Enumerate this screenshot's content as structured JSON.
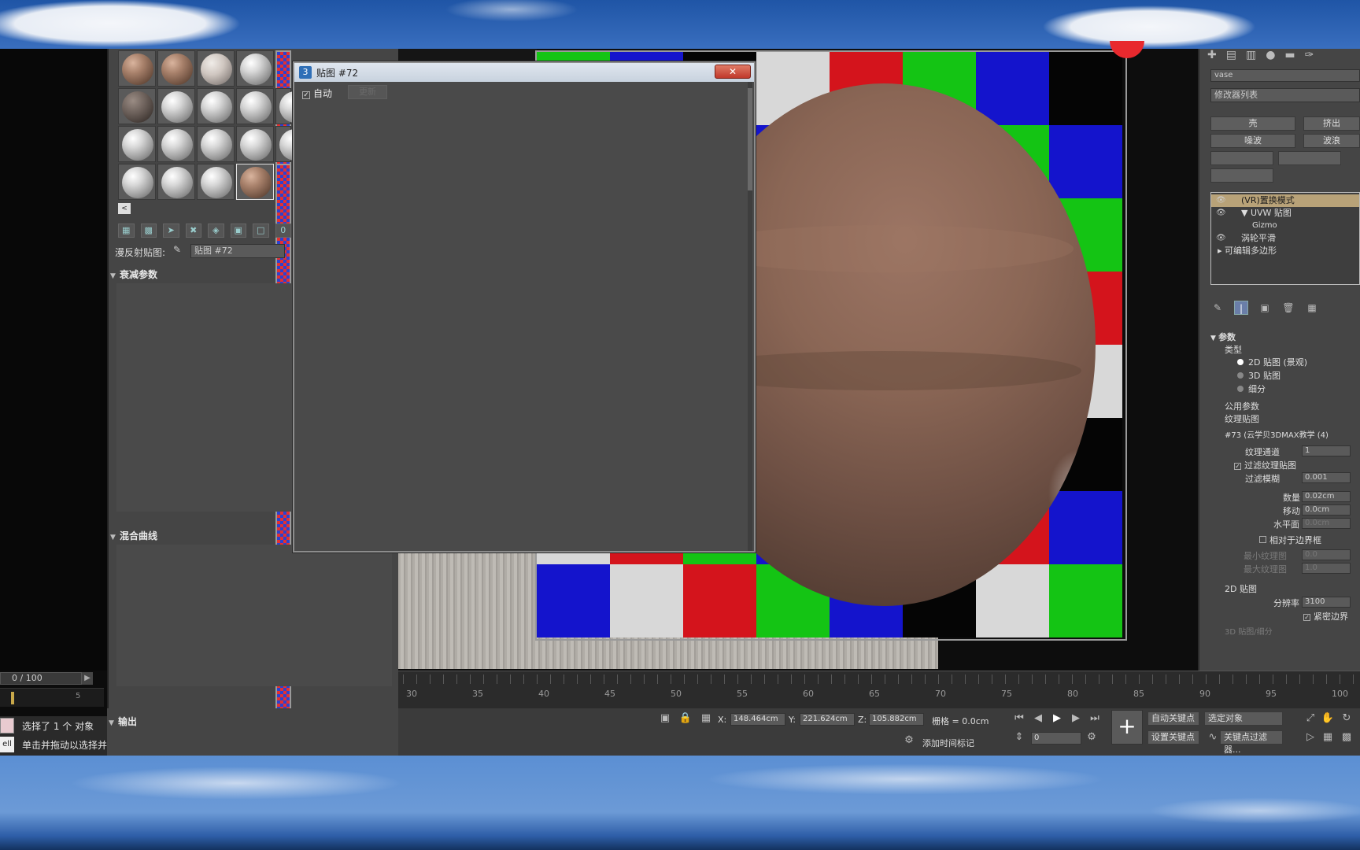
{
  "dialog": {
    "title": "贴图 #72",
    "close_label": "✕",
    "auto_label": "自动",
    "update_label": "更新"
  },
  "material_editor": {
    "reflection_map_label": "漫反射贴图:",
    "reflection_map_value": "贴图 #72",
    "rollout_falloff": "衰减参数",
    "rollout_mix_curve": "混合曲线",
    "rollout_output": "输出",
    "slot_more": "<"
  },
  "command_panel": {
    "object_name": "vase",
    "modifier_list": "修改器列表",
    "buttons": [
      "壳",
      "挤出",
      "噪波",
      "波浪"
    ],
    "stack": [
      {
        "label": "(VR)置换模式",
        "selected": true
      },
      {
        "label": "▼ UVW 贴图",
        "selected": false
      },
      {
        "label": "Gizmo",
        "selected": false
      },
      {
        "label": "涡轮平滑",
        "selected": false
      },
      {
        "label": "▸ 可编辑多边形",
        "selected": false
      }
    ],
    "params_title": "参数",
    "type_label": "类型",
    "type_options": [
      "2D 贴图 (景观)",
      "3D 贴图",
      "细分"
    ],
    "common_params": "公用参数",
    "texture_map_label": "纹理贴图",
    "texture_map_value": "#73 (云学贝3DMAX教学 (4)",
    "texture_channel_label": "纹理通道",
    "texture_channel_value": "1",
    "filter_map_label": "过滤纹理贴图",
    "filter_blur_label": "过滤模糊",
    "filter_blur_value": "0.001",
    "amount_label": "数量",
    "amount_value": "0.02cm",
    "shift_label": "移动",
    "shift_value": "0.0cm",
    "water_label": "水平面",
    "water_value": "0.0cm",
    "relative_label": "相对于边界框",
    "min_tex_label": "最小纹理图",
    "min_tex_value": "0.0",
    "max_tex_label": "最大纹理图",
    "max_tex_value": "1.0",
    "map2d_label": "2D 贴图",
    "resolution_label": "分辨率",
    "resolution_value": "3100",
    "tight_bounds_label": "紧密边界",
    "map3d_label": "3D 贴图/细分"
  },
  "timeline": {
    "frame_counter": "0 / 100",
    "mini_tick": "5",
    "ticks": [
      "30",
      "35",
      "40",
      "45",
      "50",
      "55",
      "60",
      "65",
      "70",
      "75",
      "80",
      "85",
      "90",
      "95",
      "100"
    ]
  },
  "status": {
    "selected_text": "选择了 1 个 对象",
    "hint_text": "单击并拖动以选择并",
    "swatch_text": "ell"
  },
  "coords": {
    "x_label": "X:",
    "x_value": "148.464cm",
    "y_label": "Y:",
    "y_value": "221.624cm",
    "z_label": "Z:",
    "z_value": "105.882cm",
    "grid_text": "栅格 = 0.0cm",
    "add_time_tag": "添加时间标记",
    "auto_key": "自动关键点",
    "selected_object": "选定对象",
    "set_key": "设置关键点",
    "key_filters": "关键点过滤器...",
    "frame_value": "0"
  },
  "colors": {
    "checker_red": "#d4141c",
    "checker_green": "#14c414",
    "checker_blue": "#1414cc",
    "checker_white": "#d8d8d8",
    "checker_black": "#050505",
    "selection_highlight": "#b8a278"
  }
}
